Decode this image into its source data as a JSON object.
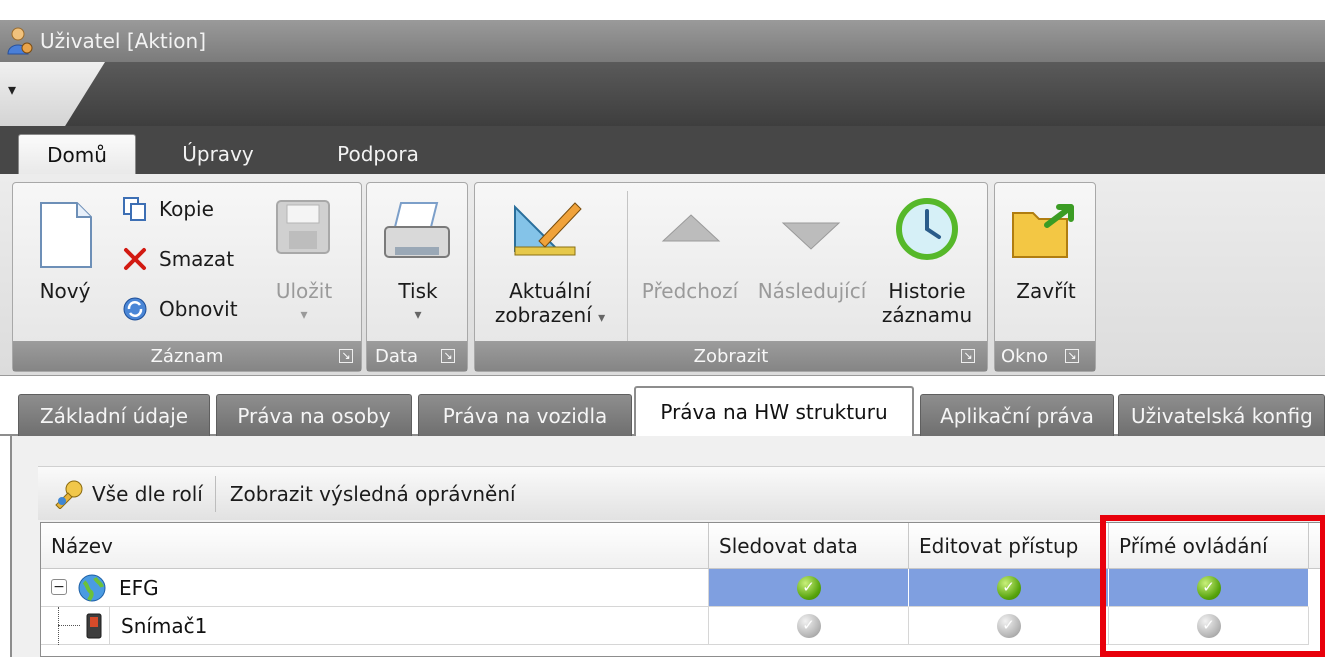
{
  "window": {
    "title": "Uživatel [Aktion]"
  },
  "ribbon_tabs": [
    {
      "label": "Domů",
      "active": true
    },
    {
      "label": "Úpravy",
      "active": false
    },
    {
      "label": "Podpora",
      "active": false
    }
  ],
  "groups": {
    "zaznam": {
      "label": "Záznam",
      "new": "Nový",
      "copy": "Kopie",
      "delete": "Smazat",
      "refresh": "Obnovit",
      "save": "Uložit"
    },
    "data": {
      "label": "Data",
      "print": "Tisk"
    },
    "zobrazit": {
      "label": "Zobrazit",
      "current_view_1": "Aktuální",
      "current_view_2": "zobrazení",
      "previous": "Předchozí",
      "next": "Následující",
      "history_1": "Historie",
      "history_2": "záznamu"
    },
    "okno": {
      "label": "Okno",
      "close": "Zavřít"
    }
  },
  "doc_tabs": [
    {
      "label": "Základní údaje",
      "active": false
    },
    {
      "label": "Práva na osoby",
      "active": false
    },
    {
      "label": "Práva na vozidla",
      "active": false
    },
    {
      "label": "Práva na HW strukturu",
      "active": true
    },
    {
      "label": "Aplikační práva",
      "active": false
    },
    {
      "label": "Uživatelská konfig",
      "active": false
    }
  ],
  "toolbar": {
    "all_by_roles": "Vše dle rolí",
    "show_result": "Zobrazit výsledná oprávnění"
  },
  "grid": {
    "columns": [
      "Název",
      "Sledovat data",
      "Editovat přístup",
      "Přímé ovládání"
    ],
    "rows": [
      {
        "name": "EFG",
        "values": [
          true,
          true,
          true
        ],
        "selected": true
      },
      {
        "name": "Snímač1",
        "values": [
          false,
          false,
          false
        ],
        "selected": false
      }
    ]
  },
  "colors": {
    "selection": "#7f9fe0",
    "highlight": "#e8000b",
    "check_enabled": "#57a40d",
    "check_inherited": "#b5b5b5"
  },
  "icons": [
    "user-app-icon",
    "qat-dropdown-icon",
    "new-document-icon",
    "copy-icon",
    "delete-icon",
    "refresh-icon",
    "save-icon",
    "printer-icon",
    "ruler-pencil-icon",
    "up-arrow-icon",
    "down-arrow-icon",
    "history-clock-icon",
    "close-folder-icon",
    "roles-key-icon",
    "collapse-icon",
    "globe-icon",
    "sensor-icon",
    "checkmark-icon"
  ]
}
